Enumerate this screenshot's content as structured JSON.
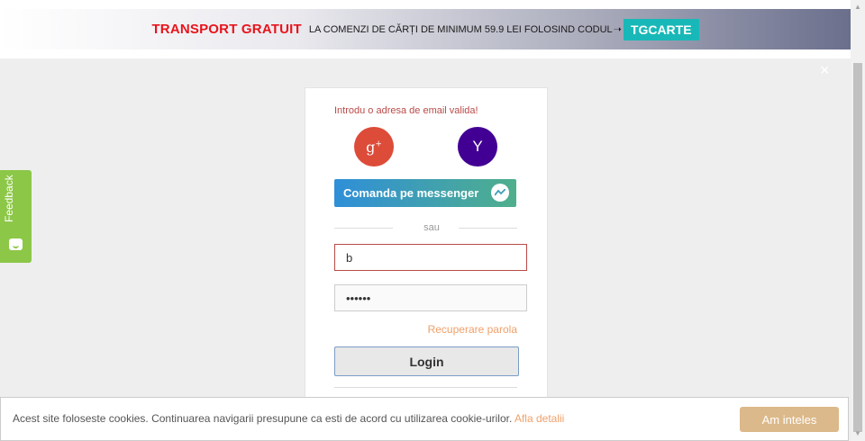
{
  "promo": {
    "highlight": "TRANSPORT GRATUIT",
    "text": "LA COMENZI DE CĂRȚI DE MINIMUM 59.9 LEI FOLOSIND CODUL",
    "arrow": "➝",
    "code": "TGCARTE"
  },
  "overlay": {
    "close_glyph": "×"
  },
  "feedback": {
    "label": "Feedback"
  },
  "login": {
    "error": "Introdu o adresa de email valida!",
    "google_glyph": "g",
    "google_plus": "+",
    "yahoo_glyph": "Y",
    "messenger_label": "Comanda pe messenger",
    "divider": "sau",
    "email_value": "b",
    "password_value": "••••••",
    "recover_label": "Recuperare parola",
    "login_label": "Login"
  },
  "cookie": {
    "text": "Acest site foloseste cookies. Continuarea navigarii presupune ca esti de acord cu utilizarea cookie-urilor.",
    "link": "Afla detalii",
    "button": "Am inteles"
  },
  "colors": {
    "promo_highlight": "#e8141c",
    "promo_code_bg": "#19b8b8",
    "google": "#dd4b39",
    "yahoo": "#410093",
    "feedback": "#8cc747",
    "accent_link": "#f0a06a",
    "cookie_button": "#dcb98a"
  }
}
